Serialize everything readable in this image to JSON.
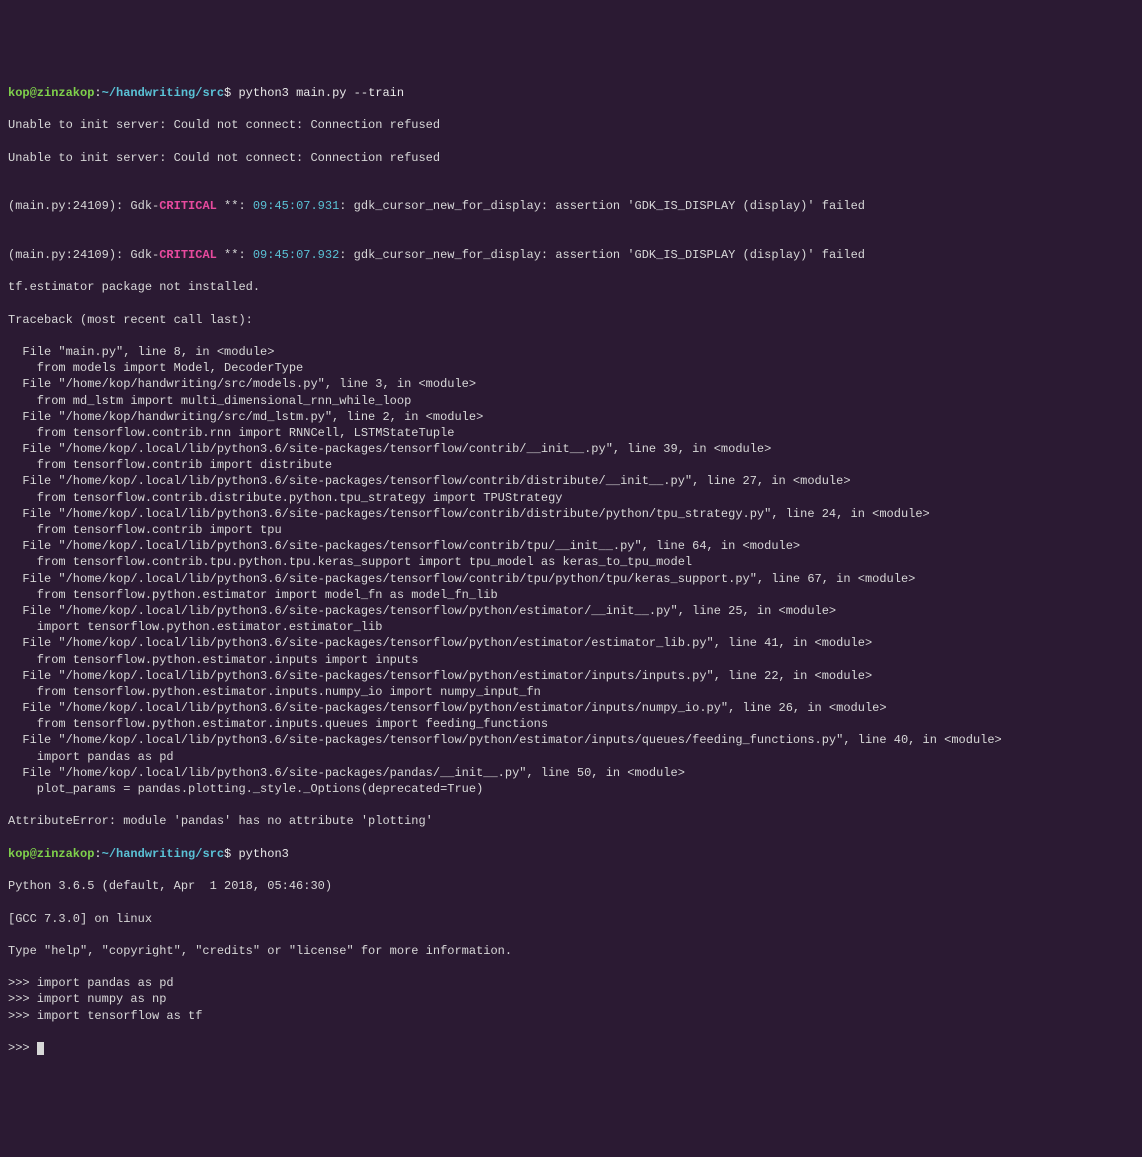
{
  "prompt1": {
    "user": "kop@zinzakop",
    "sep1": ":",
    "path": "~/handwriting/src",
    "sep2": "$ ",
    "command": "python3 main.py --train"
  },
  "err1": "Unable to init server: Could not connect: Connection refused",
  "err2": "Unable to init server: Could not connect: Connection refused",
  "blank": "",
  "gdk1": {
    "a": "(main.py:24109): Gdk-",
    "b": "CRITICAL",
    "c": " **: ",
    "d": "09:45:07.931",
    "e": ": gdk_cursor_new_for_display: assertion 'GDK_IS_DISPLAY (display)' failed"
  },
  "gdk2": {
    "a": "(main.py:24109): Gdk-",
    "b": "CRITICAL",
    "c": " **: ",
    "d": "09:45:07.932",
    "e": ": gdk_cursor_new_for_display: assertion 'GDK_IS_DISPLAY (display)' failed"
  },
  "tf_not_installed": "tf.estimator package not installed.",
  "tb_header": "Traceback (most recent call last):",
  "tb": [
    "  File \"main.py\", line 8, in <module>",
    "    from models import Model, DecoderType",
    "  File \"/home/kop/handwriting/src/models.py\", line 3, in <module>",
    "    from md_lstm import multi_dimensional_rnn_while_loop",
    "  File \"/home/kop/handwriting/src/md_lstm.py\", line 2, in <module>",
    "    from tensorflow.contrib.rnn import RNNCell, LSTMStateTuple",
    "  File \"/home/kop/.local/lib/python3.6/site-packages/tensorflow/contrib/__init__.py\", line 39, in <module>",
    "    from tensorflow.contrib import distribute",
    "  File \"/home/kop/.local/lib/python3.6/site-packages/tensorflow/contrib/distribute/__init__.py\", line 27, in <module>",
    "    from tensorflow.contrib.distribute.python.tpu_strategy import TPUStrategy",
    "  File \"/home/kop/.local/lib/python3.6/site-packages/tensorflow/contrib/distribute/python/tpu_strategy.py\", line 24, in <module>",
    "    from tensorflow.contrib import tpu",
    "  File \"/home/kop/.local/lib/python3.6/site-packages/tensorflow/contrib/tpu/__init__.py\", line 64, in <module>",
    "    from tensorflow.contrib.tpu.python.tpu.keras_support import tpu_model as keras_to_tpu_model",
    "  File \"/home/kop/.local/lib/python3.6/site-packages/tensorflow/contrib/tpu/python/tpu/keras_support.py\", line 67, in <module>",
    "    from tensorflow.python.estimator import model_fn as model_fn_lib",
    "  File \"/home/kop/.local/lib/python3.6/site-packages/tensorflow/python/estimator/__init__.py\", line 25, in <module>",
    "    import tensorflow.python.estimator.estimator_lib",
    "  File \"/home/kop/.local/lib/python3.6/site-packages/tensorflow/python/estimator/estimator_lib.py\", line 41, in <module>",
    "    from tensorflow.python.estimator.inputs import inputs",
    "  File \"/home/kop/.local/lib/python3.6/site-packages/tensorflow/python/estimator/inputs/inputs.py\", line 22, in <module>",
    "    from tensorflow.python.estimator.inputs.numpy_io import numpy_input_fn",
    "  File \"/home/kop/.local/lib/python3.6/site-packages/tensorflow/python/estimator/inputs/numpy_io.py\", line 26, in <module>",
    "    from tensorflow.python.estimator.inputs.queues import feeding_functions",
    "  File \"/home/kop/.local/lib/python3.6/site-packages/tensorflow/python/estimator/inputs/queues/feeding_functions.py\", line 40, in <module>",
    "    import pandas as pd",
    "  File \"/home/kop/.local/lib/python3.6/site-packages/pandas/__init__.py\", line 50, in <module>",
    "    plot_params = pandas.plotting._style._Options(deprecated=True)"
  ],
  "attr_err": "AttributeError: module 'pandas' has no attribute 'plotting'",
  "prompt2": {
    "user": "kop@zinzakop",
    "sep1": ":",
    "path": "~/handwriting/src",
    "sep2": "$ ",
    "command": "python3"
  },
  "pyver": "Python 3.6.5 (default, Apr  1 2018, 05:46:30)",
  "gcc": "[GCC 7.3.0] on linux",
  "help": "Type \"help\", \"copyright\", \"credits\" or \"license\" for more information.",
  "repl": [
    ">>> import pandas as pd",
    ">>> import numpy as np",
    ">>> import tensorflow as tf"
  ],
  "repl_prompt_empty": ">>> "
}
